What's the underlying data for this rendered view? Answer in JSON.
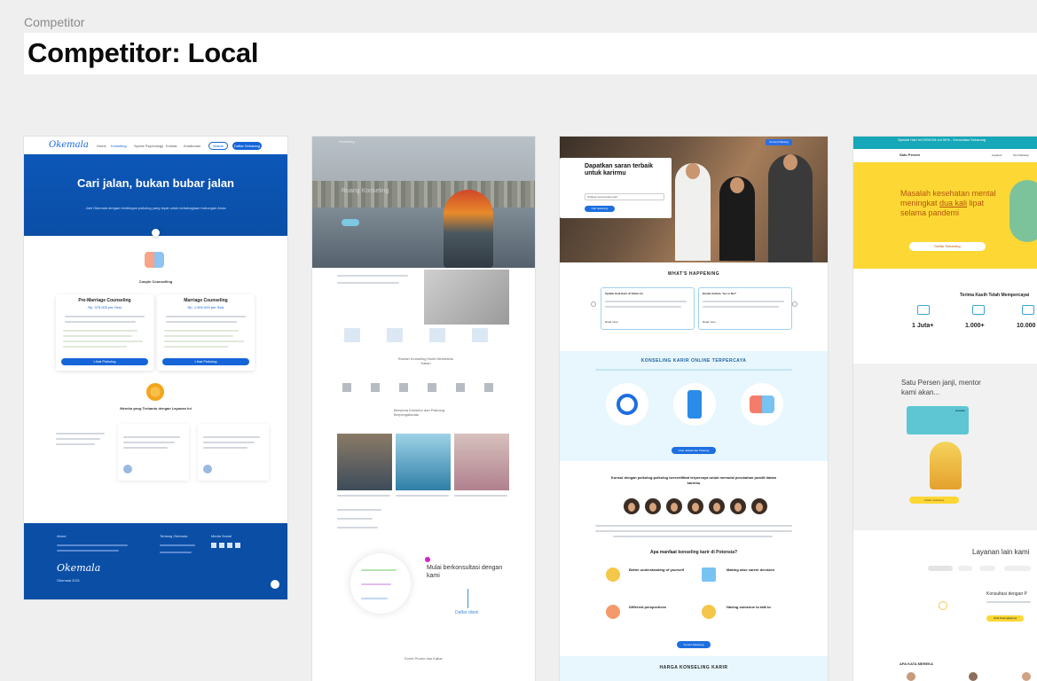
{
  "page": {
    "section_label": "Competitor",
    "title": "Competitor: Local"
  },
  "frame1": {
    "logo": "Okemala",
    "nav": [
      "Home",
      "Konseling",
      "Sports Psychology",
      "Kontak",
      "Kolaborasi"
    ],
    "btn_login": "Masuk",
    "btn_register": "Daftar Sekarang",
    "hero_title": "Cari jalan, bukan bubar jalan",
    "hero_sub": "Jadi Okemala dengan bimbingan psikolog yang tepat untuk kebahagiaan hubungan Anda",
    "couple_label": "Couple Counselling",
    "cards": [
      {
        "title": "Pre-Marriage Counseling",
        "price": "Rp. 375.000 per Sesi",
        "btn": "Lihat Psikolog"
      },
      {
        "title": "Marriage Counseling",
        "price": "Rp. 1.500.000 per Sesi",
        "btn": "Lihat Psikolog"
      }
    ],
    "testimonial_heading": "Mereka yang Terbantu dengan Layanan Ini",
    "footer_about": "About",
    "footer_col2": "Tentang Okemala",
    "footer_col3": "Media Sosial",
    "footer_logo": "Okemala",
    "footer_copy": "Okemala 2021"
  },
  "frame2": {
    "brand": "Konseling",
    "hero_text": "Ruang Konseling",
    "section1": "Rumah Konseling Hadir Membantu Kalian",
    "section2": "Bersama Konselor dan Psikolog Berpengalaman",
    "promo_text": "Mulai berkonsultasi dengan kami",
    "cta": "Daftar disini",
    "bottom_text": "Event Promo dan Kabar"
  },
  "frame3": {
    "hero_title": "Dapatkan saran terbaik untuk karirmu",
    "select_label": "Strategi menentukan karir",
    "hero_btn": "Cari sekarang",
    "nav_btn": "Konsul Psikolog",
    "whats_happening": "WHAT'S HAPPENING",
    "news_cards": [
      {
        "title": "Update Soal Karir di Tahun Ini",
        "more": "Read more"
      },
      {
        "title": "Hustle Culture, Yes or No?",
        "more": "Read more"
      }
    ],
    "section_title": "KONSELING KARIR ONLINE TERPERCAYA",
    "band_btn": "Lihat Jadwal dan Psikolog",
    "psych_title": "Konsul dengan psikolog-psikolog bersertifikat terpercaya untuk memulai perubahan positif dalam karirmu",
    "benefit_title": "Apa manfaat konseling karir di Potensia?",
    "benefits": [
      "Better understanding of yourself",
      "Making wise career decision",
      "Different perspectives",
      "Having someone to talk to"
    ],
    "benefit_btn": "Konsul Sekarang",
    "price_title": "HARGA KONSELING KARIR"
  },
  "frame4": {
    "topbar": "Spesial Hari Ini DISKON s/d 50% - Konsultasi Sekarang",
    "brand": "Satu Persen",
    "nav": [
      "Layanan",
      "Tes Psikologi"
    ],
    "hero_title_1": "Masalah kesehatan mental meningkat ",
    "hero_title_em": "dua kali",
    "hero_title_2": " lipat selama pandemi",
    "hero_btn": "Daftar Sekarang",
    "trust_title": "Terima Kasih Telah Mempercayai",
    "stats": [
      "1 Juta+",
      "1.000+",
      "10.000"
    ],
    "promise": "Satu Persen janji, mentor kami akan...",
    "speech_label": "Anonim",
    "yellow_btn": "Daftar Sekarang",
    "layanan": "Layanan lain kami",
    "konsul": "Konsultasi dengan P",
    "konsul_btn": "Lihat Selengkapnya",
    "apa_kata": "APA KATA MEREKA",
    "colors": {
      "yellow": "#fdd835",
      "teal": "#16a7b8"
    }
  }
}
